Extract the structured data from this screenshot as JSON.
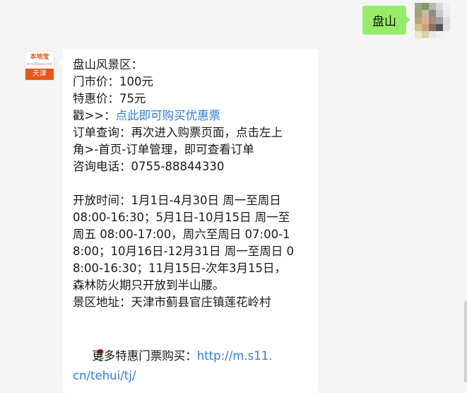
{
  "outgoing": {
    "text": "盘山"
  },
  "sender": {
    "logo_text": "本地宝",
    "logo_sub": "bendibao.com",
    "logo_city": "天津",
    "brand_color": "#e8561c"
  },
  "message": {
    "lines": [
      "盘山风景区：",
      "门市价：100元",
      "特惠价：75元"
    ],
    "buy_prefix": "戳>>：",
    "buy_link": "点此即可购买优惠票",
    "order_lines": [
      "订单查询：再次进入购票页面，点击左上",
      "角>-首页-订单管理，即可查看订单",
      "咨询电话：0755-88844330"
    ],
    "hours_lines": [
      "开放时间：1月1日-4月30日 周一至周日",
      "08:00-16:30；5月1日-10月15日 周一至",
      "周五 08:00-17:00，周六至周日 07:00-1",
      "8:00；10月16日-12月31日 周一至周日 0",
      "8:00-16:30；11月15日-次年3月15日，",
      "森林防火期只开放到半山腰。",
      "景区地址：天津市蓟县官庄镇莲花岭村"
    ],
    "more_icon": "rose-icon",
    "more_prefix": " 更多特惠门票购买：",
    "more_link_1": "http://m.s11.",
    "more_link_2": "cn/tehui/tj/"
  },
  "colors": {
    "outgoing_bubble": "#95ec69",
    "link": "#2f7fd3",
    "background": "#f5f5f5"
  }
}
